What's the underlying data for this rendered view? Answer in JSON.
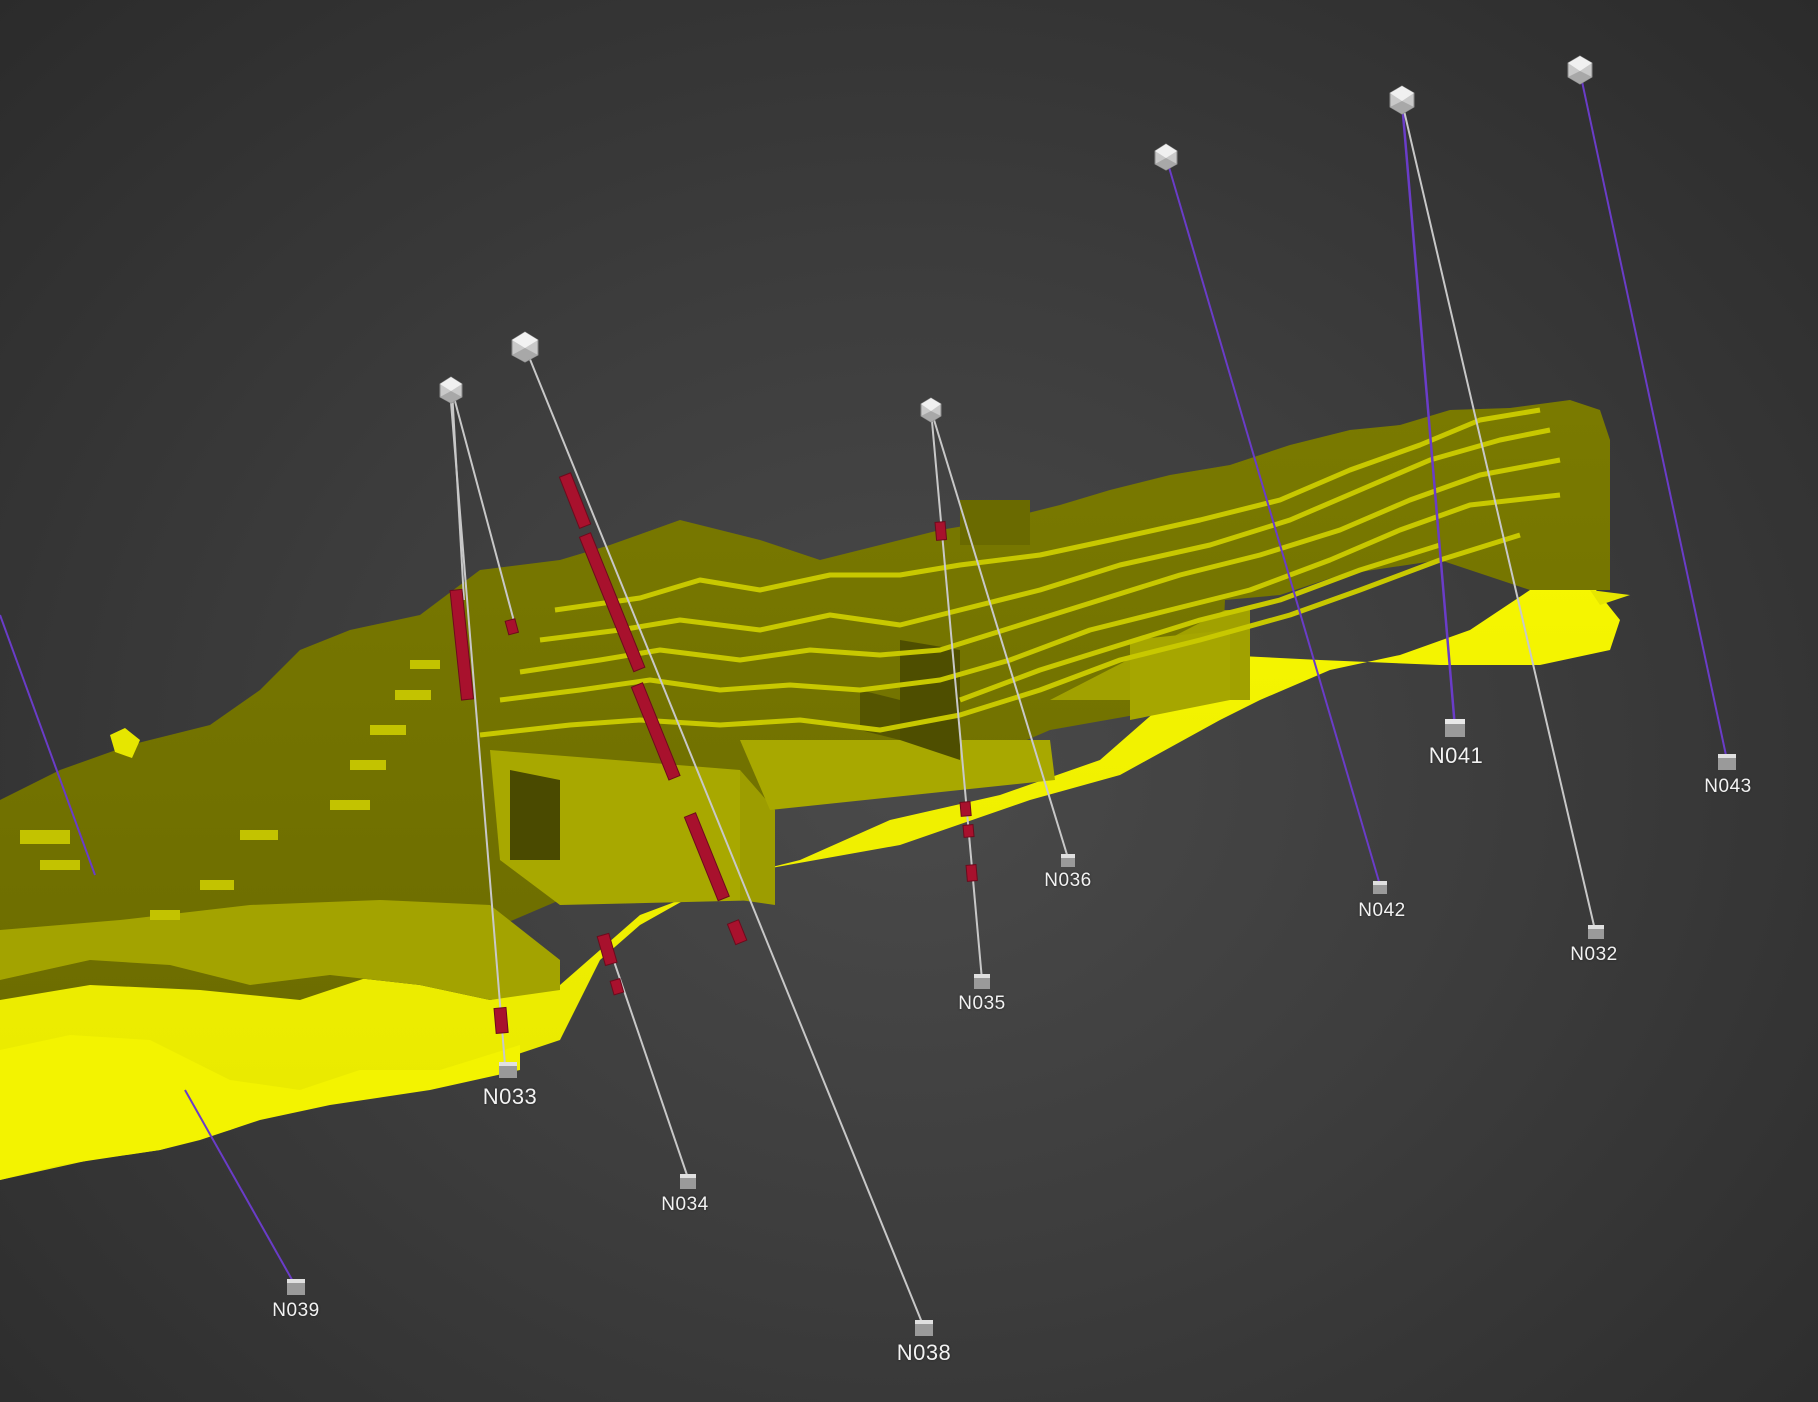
{
  "colors": {
    "background": "#3d3d3d",
    "orebody_top": "#737300",
    "orebody_side": "#a8a800",
    "orebody_bottom": "#f4f400",
    "intercept": "#a8112d",
    "trace_grey": "#c8c8c8",
    "trace_purple": "#6a3cc8",
    "collar_marker": "#d9d9d9"
  },
  "drillholes": [
    {
      "id": "N039",
      "trace": "purple",
      "collar": false
    },
    {
      "id": "N033",
      "trace": "grey",
      "collar": true
    },
    {
      "id": "N034",
      "trace": "grey",
      "collar": true
    },
    {
      "id": "N038",
      "trace": "grey",
      "collar": true
    },
    {
      "id": "N035",
      "trace": "grey",
      "collar": true
    },
    {
      "id": "N036",
      "trace": "grey",
      "collar": true
    },
    {
      "id": "N042",
      "trace": "purple",
      "collar": true
    },
    {
      "id": "N041",
      "trace": "purple",
      "collar": true
    },
    {
      "id": "N032",
      "trace": "grey",
      "collar": true
    },
    {
      "id": "N043",
      "trace": "purple",
      "collar": true
    }
  ],
  "icons": {
    "collar": "collar-marker-icon",
    "end_of_hole": "end-of-hole-cube-icon"
  }
}
